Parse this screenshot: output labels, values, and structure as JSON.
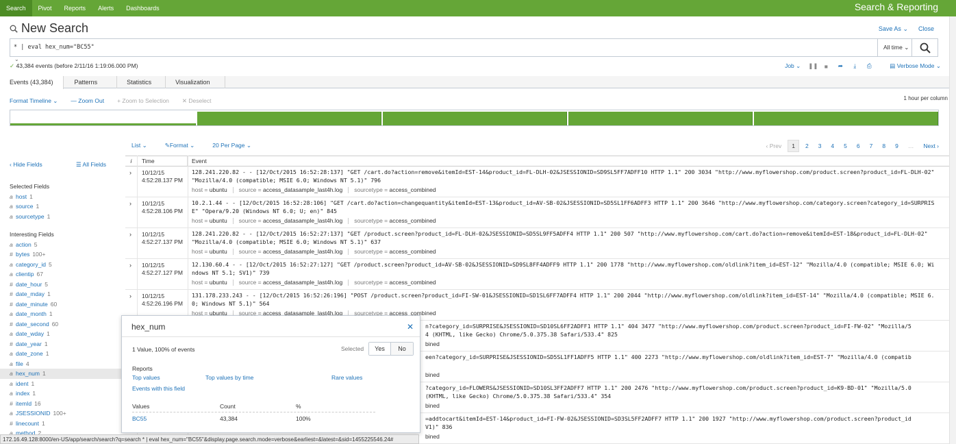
{
  "topnav": {
    "items": [
      "Search",
      "Pivot",
      "Reports",
      "Alerts",
      "Dashboards"
    ],
    "app_title": "Search & Reporting"
  },
  "header": {
    "title": "New Search",
    "save_as": "Save As",
    "close": "Close"
  },
  "search": {
    "query": "* | eval hex_num=\"BC55\"",
    "time_range": "All time"
  },
  "status": {
    "summary": "43,384 events (before 2/11/16 1:19:06.000 PM)",
    "job": "Job",
    "mode": "Verbose Mode"
  },
  "tabs": [
    "Events (43,384)",
    "Patterns",
    "Statistics",
    "Visualization"
  ],
  "timeline": {
    "format": "Format Timeline",
    "zoom_out": "— Zoom Out",
    "zoom_selection": "+ Zoom to Selection",
    "deselect": "✕ Deselect",
    "scale": "1 hour per column",
    "fill_levels": [
      0.15,
      1.0,
      1.0,
      1.0,
      1.0
    ]
  },
  "results_toolbar": {
    "list": "List",
    "format": "Format",
    "per_page": "20 Per Page"
  },
  "pager": {
    "prev": "‹ Prev",
    "pages": [
      "1",
      "2",
      "3",
      "4",
      "5",
      "6",
      "7",
      "8",
      "9"
    ],
    "ellipsis": "…",
    "next": "Next ›"
  },
  "sidebar": {
    "hide_fields": "‹ Hide Fields",
    "all_fields": "All Fields",
    "selected_header": "Selected Fields",
    "selected": [
      {
        "type": "a",
        "name": "host",
        "count": "1"
      },
      {
        "type": "a",
        "name": "source",
        "count": "1"
      },
      {
        "type": "a",
        "name": "sourcetype",
        "count": "1"
      }
    ],
    "interesting_header": "Interesting Fields",
    "interesting": [
      {
        "type": "a",
        "name": "action",
        "count": "5"
      },
      {
        "type": "#",
        "name": "bytes",
        "count": "100+"
      },
      {
        "type": "a",
        "name": "category_id",
        "count": "5"
      },
      {
        "type": "a",
        "name": "clientip",
        "count": "67"
      },
      {
        "type": "#",
        "name": "date_hour",
        "count": "5"
      },
      {
        "type": "#",
        "name": "date_mday",
        "count": "1"
      },
      {
        "type": "#",
        "name": "date_minute",
        "count": "60"
      },
      {
        "type": "a",
        "name": "date_month",
        "count": "1"
      },
      {
        "type": "#",
        "name": "date_second",
        "count": "60"
      },
      {
        "type": "a",
        "name": "date_wday",
        "count": "1"
      },
      {
        "type": "#",
        "name": "date_year",
        "count": "1"
      },
      {
        "type": "a",
        "name": "date_zone",
        "count": "1"
      },
      {
        "type": "a",
        "name": "file",
        "count": "4"
      },
      {
        "type": "a",
        "name": "hex_num",
        "count": "1"
      },
      {
        "type": "a",
        "name": "ident",
        "count": "1"
      },
      {
        "type": "a",
        "name": "index",
        "count": "1"
      },
      {
        "type": "#",
        "name": "itemId",
        "count": "16"
      },
      {
        "type": "a",
        "name": "JSESSIONID",
        "count": "100+"
      },
      {
        "type": "#",
        "name": "linecount",
        "count": "1"
      },
      {
        "type": "a",
        "name": "method",
        "count": "2"
      }
    ]
  },
  "table": {
    "headers": [
      "i",
      "Time",
      "Event"
    ],
    "meta_labels": {
      "host": "host = ",
      "source": "source = ",
      "sourcetype": "sourcetype = "
    },
    "rows": [
      {
        "date": "10/12/15",
        "time": "4:52:28.137 PM",
        "raw": "128.241.220.82 - - [12/Oct/2015 16:52:28:137] \"GET /cart.do?action=remove&itemId=EST-14&product_id=FL-DLH-02&JSESSIONID=SD9SL5FF7ADFF10 HTTP 1.1\" 200 3034 \"http://www.myflowershop.com/product.screen?product_id=FL-DLH-02\" \"Mozilla/4.0 (compatible; MSIE 6.0; Windows NT 5.1)\" 796",
        "host": "ubuntu",
        "source": "access_datasample_last4h.log",
        "sourcetype": "access_combined"
      },
      {
        "date": "10/12/15",
        "time": "4:52:28.106 PM",
        "raw": "10.2.1.44 - - [12/Oct/2015 16:52:28:106] \"GET /cart.do?action=changequantity&itemId=EST-13&product_id=AV-SB-02&JSESSIONID=SD5SL1FF6ADFF3 HTTP 1.1\" 200 3646 \"http://www.myflowershop.com/category.screen?category_id=SURPRISE\" \"Opera/9.20 (Windows NT 6.0; U; en)\" 845",
        "host": "ubuntu",
        "source": "access_datasample_last4h.log",
        "sourcetype": "access_combined"
      },
      {
        "date": "10/12/15",
        "time": "4:52:27.137 PM",
        "raw": "128.241.220.82 - - [12/Oct/2015 16:52:27:137] \"GET /product.screen?product_id=FL-DLH-02&JSESSIONID=SD5SL9FF5ADFF4 HTTP 1.1\" 200 507 \"http://www.myflowershop.com/cart.do?action=remove&itemId=EST-18&product_id=FL-DLH-02\" \"Mozilla/4.0 (compatible; MSIE 6.0; Windows NT 5.1)\" 637",
        "host": "ubuntu",
        "source": "access_datasample_last4h.log",
        "sourcetype": "access_combined"
      },
      {
        "date": "10/12/15",
        "time": "4:52:27.127 PM",
        "raw": "12.130.60.4 - - [12/Oct/2015 16:52:27:127] \"GET /product.screen?product_id=AV-SB-02&JSESSIONID=SD9SL8FF4ADFF9 HTTP 1.1\" 200 1778 \"http://www.myflowershop.com/oldlink?item_id=EST-12\" \"Mozilla/4.0 (compatible; MSIE 6.0; Windows NT 5.1; SV1)\" 739",
        "host": "ubuntu",
        "source": "access_datasample_last4h.log",
        "sourcetype": "access_combined"
      },
      {
        "date": "10/12/15",
        "time": "4:52:26.196 PM",
        "raw": "131.178.233.243 - - [12/Oct/2015 16:52:26:196] \"POST /product.screen?product_id=FI-SW-01&JSESSIONID=SD1SL6FF7ADFF4 HTTP 1.1\" 200 2044 \"http://www.myflowershop.com/oldlink?item_id=EST-14\" \"Mozilla/4.0 (compatible; MSIE 6.0; Windows NT 5.1)\" 564",
        "host": "ubuntu",
        "source": "access_datasample_last4h.log",
        "sourcetype": "access_combined"
      }
    ],
    "partial_rows": [
      {
        "line1": "n?category_id=SURPRISE&JSESSIONID=SD10SL6FF2ADFF1 HTTP 1.1\" 404 3477 \"http://www.myflowershop.com/product.screen?product_id=FI-FW-02\" \"Mozilla/5",
        "line2": "4 (KHTML, like Gecko) Chrome/5.0.375.38 Safari/533.4\" 825",
        "tail": "bined"
      },
      {
        "line1": "een?category_id=SURPRISE&JSESSIONID=SD5SL1FF1ADFF5 HTTP 1.1\" 400 2273 \"http://www.myflowershop.com/oldlink?item_id=EST-7\" \"Mozilla/4.0 (compatib",
        "line2": "",
        "tail": "bined"
      },
      {
        "line1": "?category_id=FLOWERS&JSESSIONID=SD10SL3FF2ADFF7 HTTP 1.1\" 200 2476 \"http://www.myflowershop.com/product.screen?product_id=K9-BD-01\" \"Mozilla/5.0",
        "line2": "(KHTML, like Gecko) Chrome/5.0.375.38 Safari/533.4\" 354",
        "tail": "bined"
      },
      {
        "line1": "=addtocart&itemId=EST-14&product_id=FI-FW-02&JSESSIONID=SD3SL5FF2ADFF7 HTTP 1.1\" 200 1927 \"http://www.myflowershop.com/product.screen?product_id",
        "line2": "V1)\" 836",
        "tail": "bined"
      }
    ]
  },
  "popover": {
    "title": "hex_num",
    "summary": "1 Value, 100% of events",
    "selected_label": "Selected",
    "yes": "Yes",
    "no": "No",
    "reports_header": "Reports",
    "top_values": "Top values",
    "top_values_by_time": "Top values by time",
    "rare_values": "Rare values",
    "events_with_field": "Events with this field",
    "col_values": "Values",
    "col_count": "Count",
    "col_pct": "%",
    "value": "BC55",
    "count": "43,384",
    "pct": "100%"
  },
  "statusbar": {
    "url": "172.16.49.128:8000/en-US/app/search/search?q=search * | eval hex_num=\"BC55\"&display.page.search.mode=verbose&earliest=&latest=&sid=1455225546.24#"
  },
  "colors": {
    "brand_green": "#65a637",
    "link_blue": "#1e72b8"
  }
}
